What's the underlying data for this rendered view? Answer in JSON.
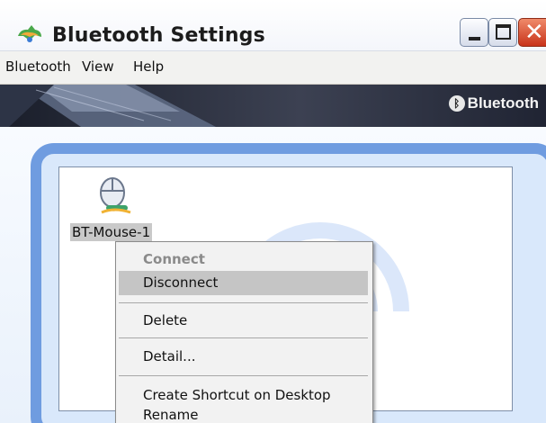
{
  "window": {
    "title": "Bluetooth Settings",
    "controls": {
      "minimize": "minimize",
      "maximize": "maximize",
      "close": "close"
    }
  },
  "menubar": {
    "items": [
      {
        "label": "Bluetooth"
      },
      {
        "label": "View"
      },
      {
        "label": "Help"
      }
    ]
  },
  "banner": {
    "brand": "Bluetooth",
    "brand_icon": "bluetooth-icon"
  },
  "devices": [
    {
      "label": "BT-Mouse-1",
      "icon": "mouse-icon",
      "selected": true
    }
  ],
  "context_menu": {
    "items": [
      {
        "label": "Connect",
        "enabled": false
      },
      {
        "label": "Disconnect",
        "highlighted": true
      },
      {
        "label": "Delete"
      },
      {
        "label": "Detail..."
      },
      {
        "label": "Create Shortcut on Desktop"
      },
      {
        "label": "Rename"
      }
    ]
  },
  "colors": {
    "frame_blue": "#6f9ce0",
    "close_red": "#c8331a",
    "banner_dark": "#1a1e2a"
  }
}
